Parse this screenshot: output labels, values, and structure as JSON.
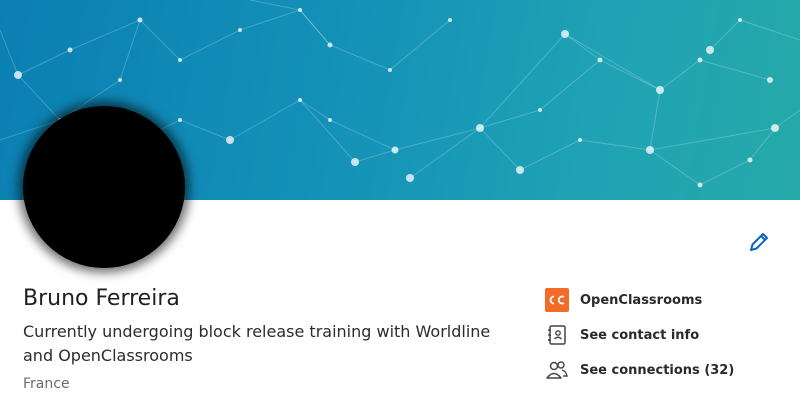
{
  "profile": {
    "name": "Bruno Ferreira",
    "headline": "Currently undergoing block release training with Worldline and OpenClassrooms",
    "location": "France"
  },
  "side_links": {
    "company": "OpenClassrooms",
    "contact": "See contact info",
    "connections": "See connections (32)"
  },
  "colors": {
    "banner_start": "#0b7fb2",
    "banner_end": "#26a9a8",
    "company_logo": "#f26b27",
    "edit_icon": "#0a66c2"
  },
  "icons": [
    "pencil-icon",
    "openclassrooms-logo",
    "contact-card-icon",
    "people-icon"
  ]
}
